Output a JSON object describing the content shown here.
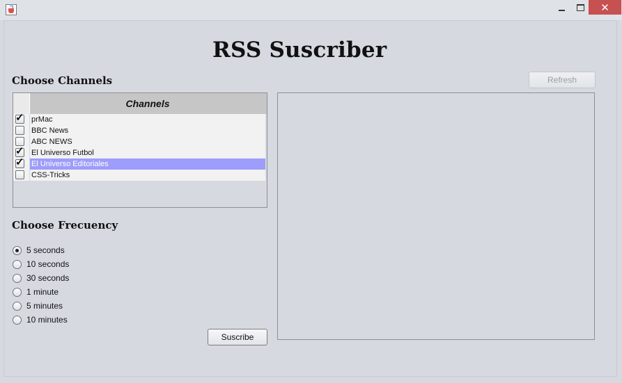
{
  "window": {
    "title": "",
    "minimize_symbol": "",
    "close_symbol": "✕"
  },
  "app": {
    "title": "RSS Suscriber"
  },
  "channels": {
    "heading": "Choose Channels",
    "column_header": "Channels",
    "rows": [
      {
        "label": "prMac",
        "checked": true,
        "selected": false
      },
      {
        "label": "BBC News",
        "checked": false,
        "selected": false
      },
      {
        "label": "ABC NEWS",
        "checked": false,
        "selected": false
      },
      {
        "label": "El Universo Futbol",
        "checked": true,
        "selected": false
      },
      {
        "label": "El Universo Editoriales",
        "checked": true,
        "selected": true
      },
      {
        "label": "CSS-Tricks",
        "checked": false,
        "selected": false
      }
    ]
  },
  "refresh": {
    "label": "Refresh",
    "enabled": false
  },
  "frequency": {
    "heading": "Choose Frecuency",
    "options": [
      {
        "label": "5 seconds",
        "checked": true
      },
      {
        "label": "10 seconds",
        "checked": false
      },
      {
        "label": "30 seconds",
        "checked": false
      },
      {
        "label": "1 minute",
        "checked": false
      },
      {
        "label": "5 minutes",
        "checked": false
      },
      {
        "label": "10 minutes",
        "checked": false
      }
    ]
  },
  "subscribe": {
    "label": "Suscribe"
  },
  "colors": {
    "selection": "#9d9dfb",
    "background": "#d6d9e0",
    "close_button": "#c75050"
  }
}
